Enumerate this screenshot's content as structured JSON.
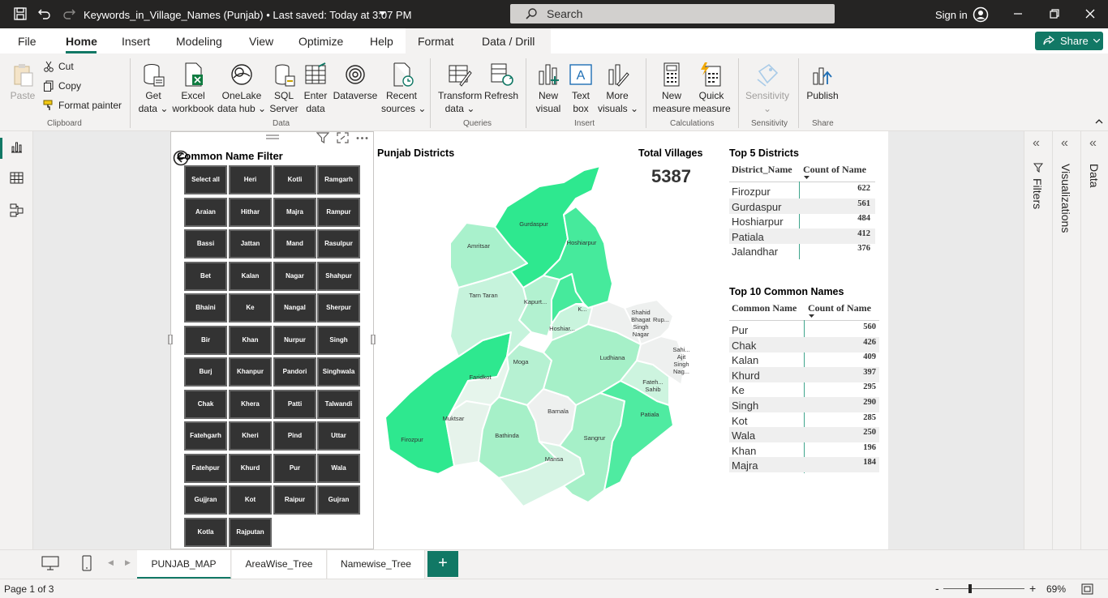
{
  "titlebar": {
    "title": "Keywords_in_Village_Names (Punjab)  •  Last saved: Today at 3:07 PM",
    "search_placeholder": "Search",
    "signin": "Sign in"
  },
  "menu": {
    "items": [
      "File",
      "Home",
      "Insert",
      "Modeling",
      "View",
      "Optimize",
      "Help",
      "Format",
      "Data / Drill"
    ],
    "active": "Home",
    "share": "Share"
  },
  "ribbon": {
    "clipboard": {
      "paste": "Paste",
      "cut": "Cut",
      "copy": "Copy",
      "format_painter": "Format painter",
      "group": "Clipboard"
    },
    "data": {
      "items": [
        {
          "l1": "Get",
          "l2": "data ⌄"
        },
        {
          "l1": "Excel",
          "l2": "workbook"
        },
        {
          "l1": "OneLake",
          "l2": "data hub ⌄"
        },
        {
          "l1": "SQL",
          "l2": "Server"
        },
        {
          "l1": "Enter",
          "l2": "data"
        },
        {
          "l1": "Dataverse",
          "l2": ""
        },
        {
          "l1": "Recent",
          "l2": "sources ⌄"
        }
      ],
      "group": "Data"
    },
    "queries": {
      "items": [
        {
          "l1": "Transform",
          "l2": "data ⌄"
        },
        {
          "l1": "Refresh",
          "l2": ""
        }
      ],
      "group": "Queries"
    },
    "insert": {
      "items": [
        {
          "l1": "New",
          "l2": "visual"
        },
        {
          "l1": "Text",
          "l2": "box"
        },
        {
          "l1": "More",
          "l2": "visuals ⌄"
        }
      ],
      "group": "Insert"
    },
    "calculations": {
      "items": [
        {
          "l1": "New",
          "l2": "measure"
        },
        {
          "l1": "Quick",
          "l2": "measure"
        }
      ],
      "group": "Calculations"
    },
    "sensitivity": {
      "items": [
        {
          "l1": "Sensitivity",
          "l2": "⌄"
        }
      ],
      "group": "Sensitivity"
    },
    "share": {
      "items": [
        {
          "l1": "Publish",
          "l2": ""
        }
      ],
      "group": "Share"
    }
  },
  "slicer": {
    "title": "Common Name Filter",
    "chips": [
      "Select all",
      "Heri",
      "Kotli",
      "Ramgarh",
      "Araian",
      "Hithar",
      "Majra",
      "Rampur",
      "Bassi",
      "Jattan",
      "Mand",
      "Rasulpur",
      "Bet",
      "Kalan",
      "Nagar",
      "Shahpur",
      "Bhaini",
      "Ke",
      "Nangal",
      "Sherpur",
      "Bir",
      "Khan",
      "Nurpur",
      "Singh",
      "Burj",
      "Khanpur",
      "Pandori",
      "Singhwala",
      "Chak",
      "Khera",
      "Patti",
      "Talwandi",
      "Fatehgarh",
      "Kheri",
      "Pind",
      "Uttar",
      "Fatehpur",
      "Khurd",
      "Pur",
      "Wala",
      "Gujjran",
      "Kot",
      "Raipur",
      "Gujran",
      "Kotla",
      "Rajputan"
    ]
  },
  "map": {
    "title": "Punjab Districts",
    "districts": [
      {
        "name": "Gurdaspur",
        "color": "#2ee88f"
      },
      {
        "name": "Hoshiarpur",
        "color": "#46ea9c"
      },
      {
        "name": "Amritsar",
        "color": "#a9f1cc"
      },
      {
        "name": "Tarn Taran",
        "color": "#c6f3dc"
      },
      {
        "name": "Kapurt...",
        "color": "#b2f1d0"
      },
      {
        "name": "K...",
        "color": "#c9f4dd"
      },
      {
        "name": "Hoshiar...",
        "color": "#46ea9c"
      },
      {
        "name": "Shahid Bhagat Singh Nagar",
        "color": "#eef0ef"
      },
      {
        "name": "Rup...",
        "color": "#eef0ef"
      },
      {
        "name": "Ludhiana",
        "color": "#a6f0c8"
      },
      {
        "name": "Sahi... Ajit Singh Nag...",
        "color": "#eef0ef"
      },
      {
        "name": "Fateh... Sahib",
        "color": "#cdf4df"
      },
      {
        "name": "Patiala",
        "color": "#4feba1"
      },
      {
        "name": "Moga",
        "color": "#b6f1d2"
      },
      {
        "name": "Faridkot",
        "color": "#e6f5ec"
      },
      {
        "name": "Firozpur",
        "color": "#2ee88f"
      },
      {
        "name": "Muktsar",
        "color": "#e6f3eb"
      },
      {
        "name": "Bathinda",
        "color": "#a6f0c8"
      },
      {
        "name": "Barnala",
        "color": "#eef0ef"
      },
      {
        "name": "Mansa",
        "color": "#d6f4e4"
      },
      {
        "name": "Sangrur",
        "color": "#a6f0c8"
      }
    ]
  },
  "kpi": {
    "title": "Total Villages",
    "value": "5387"
  },
  "top5": {
    "title": "Top 5 Districts",
    "col1": "District_Name",
    "col2": "Count of Name",
    "rows": [
      {
        "name": "Firozpur",
        "value": "622"
      },
      {
        "name": "Gurdaspur",
        "value": "561"
      },
      {
        "name": "Hoshiarpur",
        "value": "484"
      },
      {
        "name": "Patiala",
        "value": "412"
      },
      {
        "name": "Jalandhar",
        "value": "376"
      }
    ]
  },
  "top10": {
    "title": "Top 10 Common Names",
    "col1": "Common Name",
    "col2": "Count of Name",
    "rows": [
      {
        "name": "Pur",
        "value": "560"
      },
      {
        "name": "Chak",
        "value": "426"
      },
      {
        "name": "Kalan",
        "value": "409"
      },
      {
        "name": "Khurd",
        "value": "397"
      },
      {
        "name": "Ke",
        "value": "295"
      },
      {
        "name": "Singh",
        "value": "290"
      },
      {
        "name": "Kot",
        "value": "285"
      },
      {
        "name": "Wala",
        "value": "250"
      },
      {
        "name": "Khan",
        "value": "196"
      },
      {
        "name": "Majra",
        "value": "184"
      }
    ]
  },
  "panes": {
    "filters": "Filters",
    "visualizations": "Visualizations",
    "data": "Data"
  },
  "tabs": {
    "items": [
      "PUNJAB_MAP",
      "AreaWise_Tree",
      "Namewise_Tree"
    ],
    "active": "PUNJAB_MAP",
    "add": "+"
  },
  "status": {
    "page": "Page 1 of 3",
    "zoom": "69%",
    "zoom_level": 0.69
  }
}
